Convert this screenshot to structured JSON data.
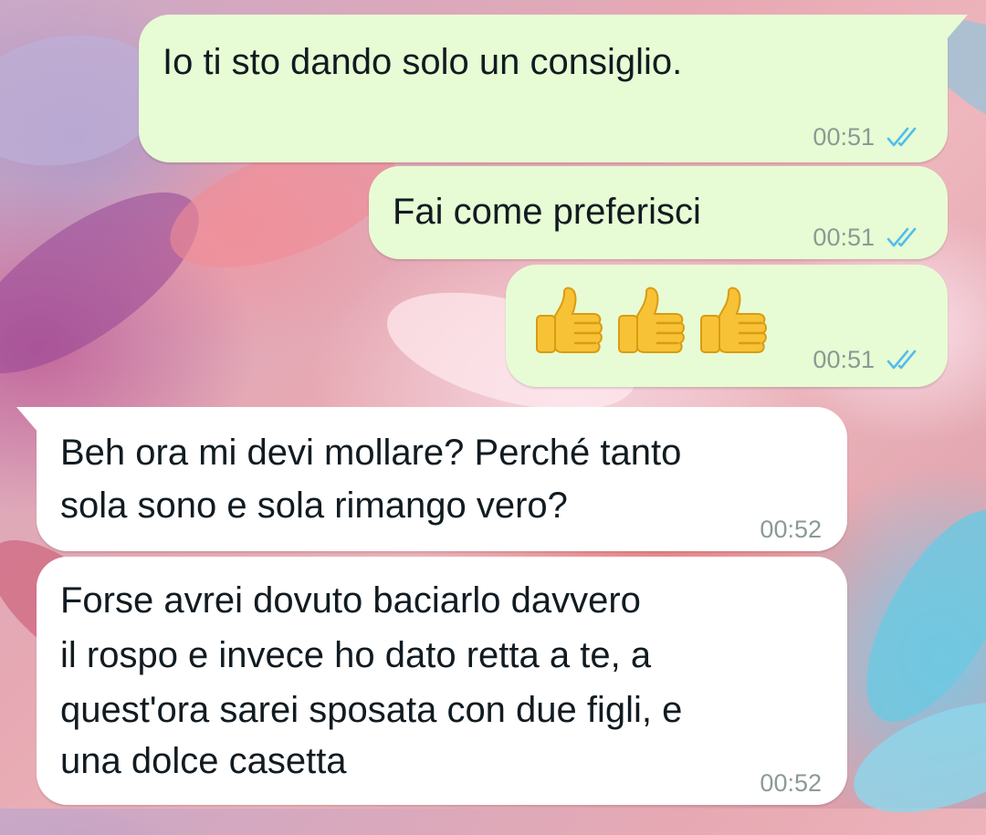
{
  "messages": [
    {
      "direction": "outgoing",
      "text": "Io ti sto dando solo un consiglio.",
      "time": "00:51",
      "status": "read"
    },
    {
      "direction": "outgoing",
      "text": "Fai come preferisci",
      "time": "00:51",
      "status": "read"
    },
    {
      "direction": "outgoing",
      "emoji": [
        "thumbs-up",
        "thumbs-up",
        "thumbs-up"
      ],
      "time": "00:51",
      "status": "read"
    },
    {
      "direction": "incoming",
      "text_lines": [
        "Beh ora mi devi mollare? Perché tanto",
        "sola sono e sola rimango vero?"
      ],
      "time": "00:52"
    },
    {
      "direction": "incoming",
      "text_lines": [
        "Forse avrei dovuto baciarlo davvero",
        "il rospo e invece ho dato retta a te, a",
        "quest'ora sarei sposata con due figli, e",
        "una dolce casetta"
      ],
      "time": "00:52"
    }
  ],
  "colors": {
    "outgoing_bubble": "#e7fcd4",
    "incoming_bubble": "#ffffff",
    "read_ticks": "#53bdeb",
    "timestamp": "#8b9a95"
  }
}
